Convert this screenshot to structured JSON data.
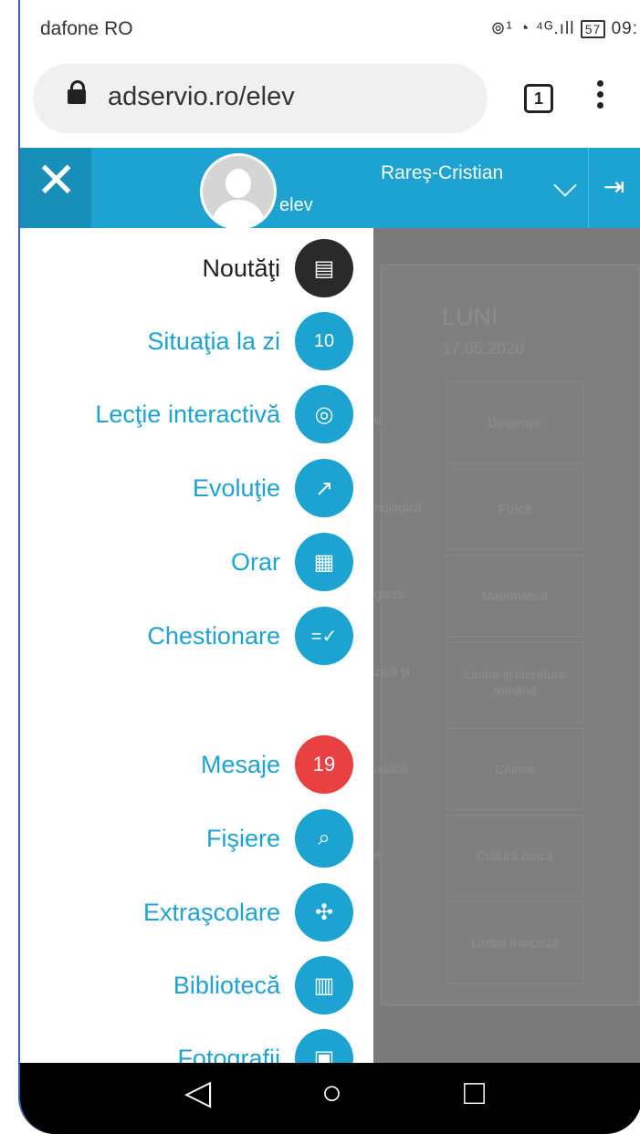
{
  "status_bar": {
    "carrier": "dafone RO",
    "right_text": "⊚¹ ◔ ⁴ᴳ.ıll",
    "battery": "57",
    "time": "09:"
  },
  "browser": {
    "url": "adservio.ro/elev",
    "tab_count": "1"
  },
  "header": {
    "user_name": "Rareş-Cristian",
    "role": "elev"
  },
  "menu": [
    {
      "label": "Noutăţi",
      "icon": "news-icon",
      "glyph": "▤"
    },
    {
      "label": "Situaţia la zi",
      "icon": "grades-icon",
      "glyph": "10"
    },
    {
      "label": "Lecţie interactivă",
      "icon": "webcam-icon",
      "glyph": "◎"
    },
    {
      "label": "Evoluţie",
      "icon": "trend-chart-icon",
      "glyph": "↗"
    },
    {
      "label": "Orar",
      "icon": "calendar-icon",
      "glyph": "▦"
    },
    {
      "label": "Chestionare",
      "icon": "quiz-check-icon",
      "glyph": "=✓"
    },
    {
      "label": "Mesaje",
      "icon": "messages-badge",
      "glyph": "19"
    },
    {
      "label": "Fişiere",
      "icon": "paperclip-icon",
      "glyph": "⌕"
    },
    {
      "label": "Extraşcolare",
      "icon": "activities-icon",
      "glyph": "✣"
    },
    {
      "label": "Bibliotecă",
      "icon": "books-icon",
      "glyph": "▥"
    },
    {
      "label": "Fotografii",
      "icon": "photos-icon",
      "glyph": "▣"
    }
  ],
  "background": {
    "day": "LUNI",
    "date": "17.05.2020",
    "left_fragments": [
      "e",
      "nologică",
      "gleză",
      "zică şi",
      "astică",
      "e"
    ],
    "subjects": [
      "Dirigenţie",
      "Fizică",
      "Matematică",
      "Limba şi literatura română",
      "Chimie",
      "Cultură civică",
      "Limba franceză"
    ]
  },
  "nav": {
    "back": "◁",
    "home": "○",
    "recents": "□"
  }
}
